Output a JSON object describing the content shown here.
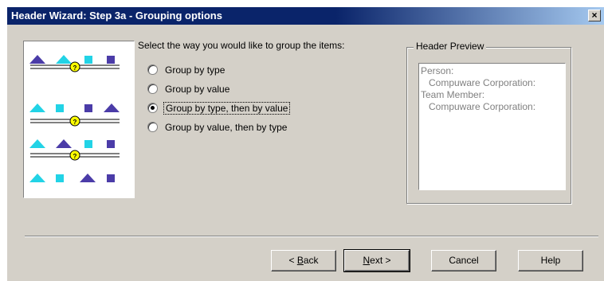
{
  "window": {
    "title": "Header Wizard: Step 3a - Grouping options",
    "close_glyph": "×"
  },
  "illustration": {
    "icon": "grouping-illustration",
    "colors": {
      "purple": "#4b3ca8",
      "cyan": "#22d3e6",
      "badge": "#ffff00"
    }
  },
  "options": {
    "prompt": "Select the way you would like to group the items:",
    "items": [
      {
        "label": "Group by type",
        "selected": false
      },
      {
        "label": "Group by value",
        "selected": false
      },
      {
        "label": "Group by type, then by value",
        "selected": true
      },
      {
        "label": "Group by value, then by type",
        "selected": false
      }
    ]
  },
  "preview": {
    "title": "Header Preview",
    "lines": [
      {
        "text": "Person:",
        "indent": false
      },
      {
        "text": "Compuware Corporation:",
        "indent": true
      },
      {
        "text": "Team Member:",
        "indent": true
      },
      {
        "text": "Compuware Corporation:",
        "indent": true
      }
    ]
  },
  "buttons": {
    "back": {
      "prefix": "< ",
      "mnemonic": "B",
      "rest": "ack"
    },
    "next": {
      "prefix": "",
      "mnemonic": "N",
      "rest": "ext >"
    },
    "cancel": "Cancel",
    "help": "Help"
  }
}
